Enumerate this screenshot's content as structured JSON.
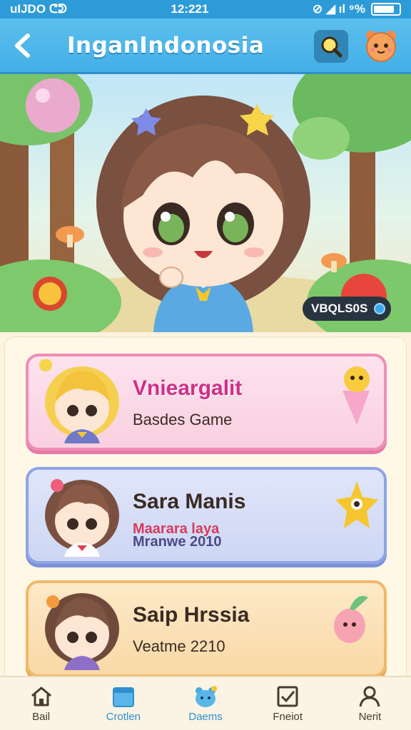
{
  "status_bar": {
    "left": "uIJDO ᕦᕲ",
    "time": "12:221",
    "right": "⊘ ◢ ıl ⁹%"
  },
  "header": {
    "back_icon": "back-arrow-icon",
    "title": "InganIndonosia",
    "search_icon": "search-icon",
    "mascot_icon": "mascot-icon"
  },
  "hero": {
    "badge": "VBQLS0S"
  },
  "cards": [
    {
      "name": "Vnieargalit",
      "subtitle": "Basdes Game",
      "accent": "#ef8fb7"
    },
    {
      "name": "Sara Manis",
      "subtitle_line1": "Maarara   laya",
      "subtitle_line2": "Mranwe  2010",
      "accent": "#8ea4e4"
    },
    {
      "name": "Saip Hrssia",
      "subtitle": "Veatme 2210",
      "accent": "#f1b869"
    }
  ],
  "nav": [
    {
      "label": "Bail",
      "icon": "home-icon"
    },
    {
      "label": "Crotlen",
      "icon": "calendar-icon",
      "active": true
    },
    {
      "label": "Daems",
      "icon": "mascot-icon",
      "active": true
    },
    {
      "label": "Fneiot",
      "icon": "checkbox-icon"
    },
    {
      "label": "Nerit",
      "icon": "profile-icon"
    }
  ]
}
